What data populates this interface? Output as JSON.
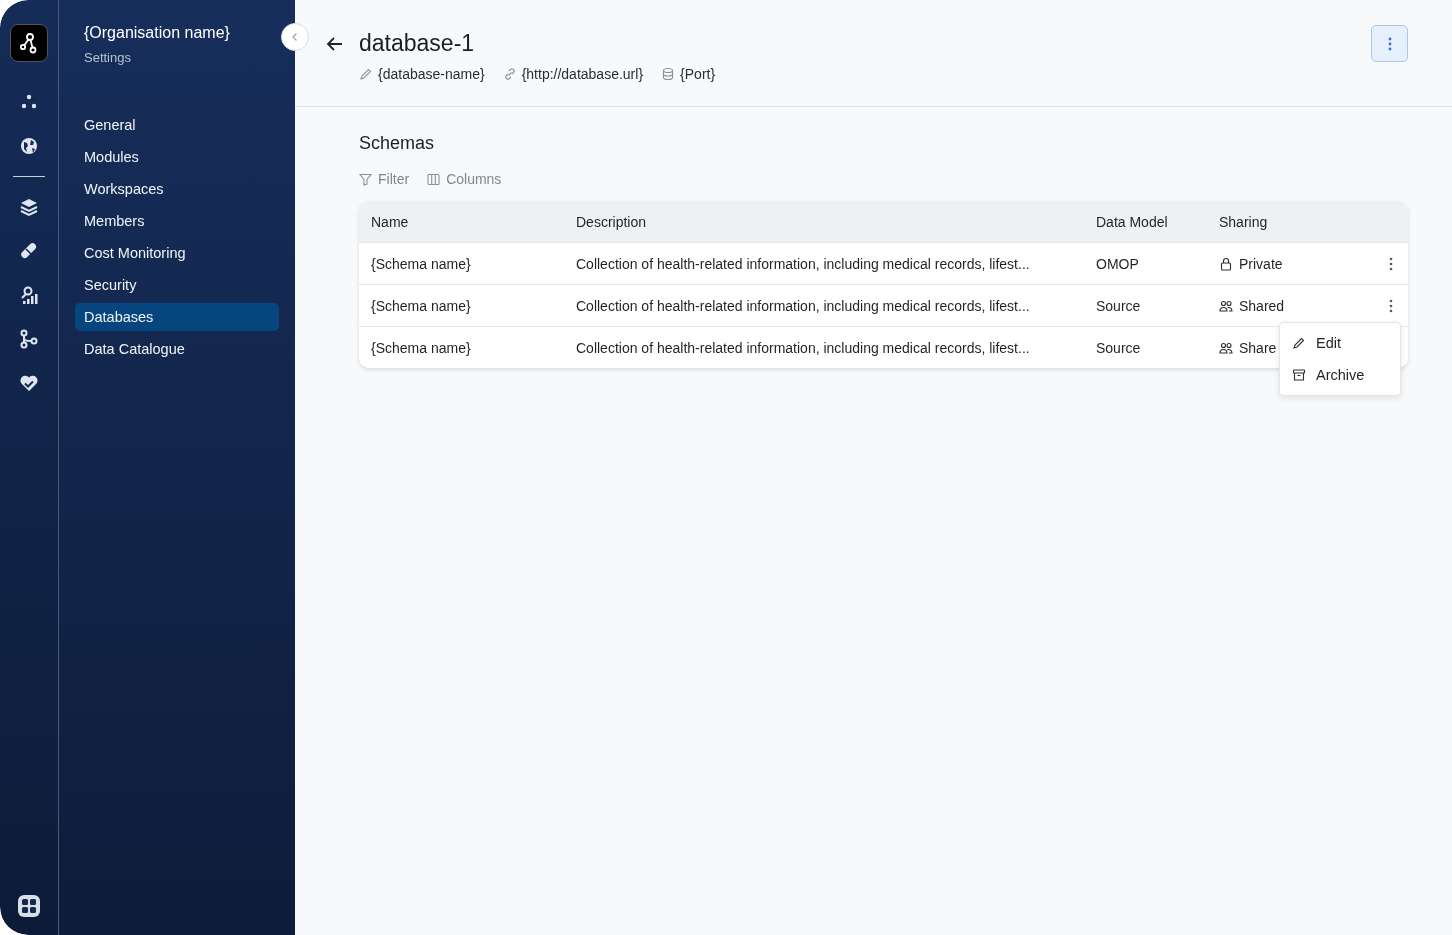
{
  "rail": {
    "items": [
      {
        "kind": "dots"
      },
      {
        "kind": "globe"
      },
      {
        "kind": "divider"
      },
      {
        "kind": "layers"
      },
      {
        "kind": "pill"
      },
      {
        "kind": "analytics"
      },
      {
        "kind": "branch"
      },
      {
        "kind": "heart"
      }
    ]
  },
  "sidebar": {
    "title": "{Organisation name}",
    "subtitle": "Settings",
    "items": [
      {
        "label": "General",
        "selected": false
      },
      {
        "label": "Modules",
        "selected": false
      },
      {
        "label": "Workspaces",
        "selected": false
      },
      {
        "label": "Members",
        "selected": false
      },
      {
        "label": "Cost Monitoring",
        "selected": false
      },
      {
        "label": "Security",
        "selected": false
      },
      {
        "label": "Databases",
        "selected": true
      },
      {
        "label": "Data Catalogue",
        "selected": false
      }
    ]
  },
  "header": {
    "title": "database-1",
    "meta": [
      {
        "kind": "pencil",
        "text": "{database-name}"
      },
      {
        "kind": "link",
        "text": "{http://database.url}"
      },
      {
        "kind": "database",
        "text": "{Port}"
      }
    ]
  },
  "section": {
    "title": "Schemas",
    "tools": [
      {
        "kind": "filter",
        "label": "Filter"
      },
      {
        "kind": "columns",
        "label": "Columns"
      }
    ]
  },
  "table": {
    "columns": [
      "Name",
      "Description",
      "Data Model",
      "Sharing"
    ],
    "rows": [
      {
        "name": "{Schema name}",
        "description": "Collection of health-related information, including medical records, lifest...",
        "model": "OMOP",
        "sharing": {
          "kind": "private",
          "text": "Private"
        },
        "kebab": true
      },
      {
        "name": "{Schema name}",
        "description": "Collection of health-related information, including medical records, lifest...",
        "model": "Source",
        "sharing": {
          "kind": "shared",
          "text": "Shared"
        },
        "kebab": true
      },
      {
        "name": "{Schema name}",
        "description": "Collection of health-related information, including medical records, lifest...",
        "model": "Source",
        "sharing": {
          "kind": "shared",
          "text": "Share"
        }
      }
    ]
  },
  "context_menu": {
    "items": [
      {
        "kind": "edit",
        "label": "Edit"
      },
      {
        "kind": "archive",
        "label": "Archive"
      }
    ]
  }
}
